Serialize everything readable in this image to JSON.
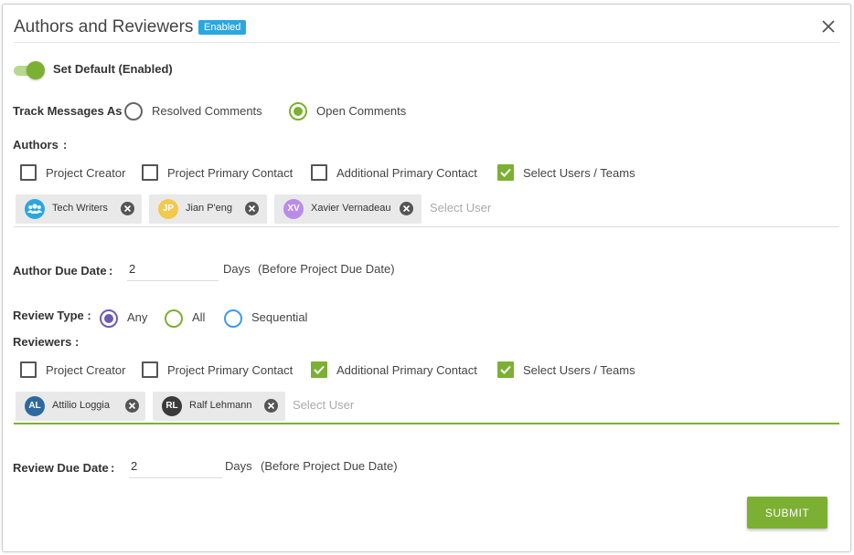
{
  "header": {
    "title": "Authors and Reviewers",
    "badge": "Enabled"
  },
  "default_toggle": {
    "label": "Set Default (Enabled)",
    "on": true
  },
  "track_messages": {
    "label": "Track Messages As",
    "options": [
      "Resolved Comments",
      "Open Comments"
    ],
    "selected": "Open Comments"
  },
  "authors": {
    "label": "Authors",
    "colon": ":",
    "checkboxes": [
      {
        "label": "Project Creator",
        "checked": false
      },
      {
        "label": "Project Primary Contact",
        "checked": false
      },
      {
        "label": "Additional Primary Contact",
        "checked": false
      },
      {
        "label": "Select Users / Teams",
        "checked": true
      }
    ],
    "chips": [
      {
        "name": "Tech Writers",
        "initials": "",
        "icon": "team-icon",
        "color": "#2aa7e0"
      },
      {
        "name": "Jian P'eng",
        "initials": "JP",
        "color": "#f2c94c"
      },
      {
        "name": "Xavier Vernadeau",
        "initials": "XV",
        "color": "#b98ce8"
      }
    ],
    "select_placeholder": "Select User"
  },
  "author_due": {
    "label": "Author Due Date",
    "colon": ":",
    "value": "2",
    "unit": "Days",
    "note": "(Before Project Due Date)"
  },
  "review_type": {
    "label": "Review Type :",
    "options": [
      "Any",
      "All",
      "Sequential"
    ],
    "selected": "Any"
  },
  "reviewers": {
    "label": "Reviewers",
    "colon": ":",
    "checkboxes": [
      {
        "label": "Project Creator",
        "checked": false
      },
      {
        "label": "Project Primary Contact",
        "checked": false
      },
      {
        "label": "Additional Primary Contact",
        "checked": true
      },
      {
        "label": "Select Users / Teams",
        "checked": true
      }
    ],
    "chips": [
      {
        "name": "Attilio Loggia",
        "initials": "AL",
        "color": "#2c6a9e"
      },
      {
        "name": "Ralf Lehmann",
        "initials": "RL",
        "color": "#3a3a3a"
      }
    ],
    "select_placeholder": "Select User"
  },
  "review_due": {
    "label": "Review Due Date",
    "colon": ":",
    "value": "2",
    "unit": "Days",
    "note": "(Before Project Due Date)"
  },
  "submit_label": "SUBMIT",
  "colors": {
    "accent": "#7cb033",
    "badge": "#2aa7e0"
  }
}
